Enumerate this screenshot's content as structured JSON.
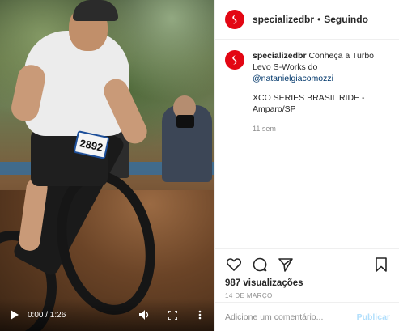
{
  "video": {
    "bib_number": "2892",
    "time_display": "0:00 / 1:26",
    "play_icon": "play-icon",
    "volume_icon": "volume-icon",
    "fullscreen_icon": "fullscreen-icon",
    "more_icon": "more-vert-icon"
  },
  "header": {
    "username": "specializedbr",
    "separator": "•",
    "follow_state": "Seguindo"
  },
  "caption": {
    "username": "specializedbr",
    "text_before": "Conheça a Turbo Levo S-Works do ",
    "mention": "@natanielgiacomozzi",
    "event_line": "XCO SERIES BRASIL RIDE - Amparo/SP",
    "time_ago": "11 sem"
  },
  "actions": {
    "like_icon": "heart-icon",
    "comment_icon": "comment-icon",
    "share_icon": "send-icon",
    "save_icon": "bookmark-icon",
    "views": "987 visualizações",
    "date": "14 de março"
  },
  "comment_box": {
    "placeholder": "Adicione um comentário...",
    "publish_label": "Publicar"
  },
  "colors": {
    "brand": "#e30613",
    "mention": "#00376b",
    "muted": "#8e8e8e",
    "publish_disabled": "#b2dffc"
  }
}
